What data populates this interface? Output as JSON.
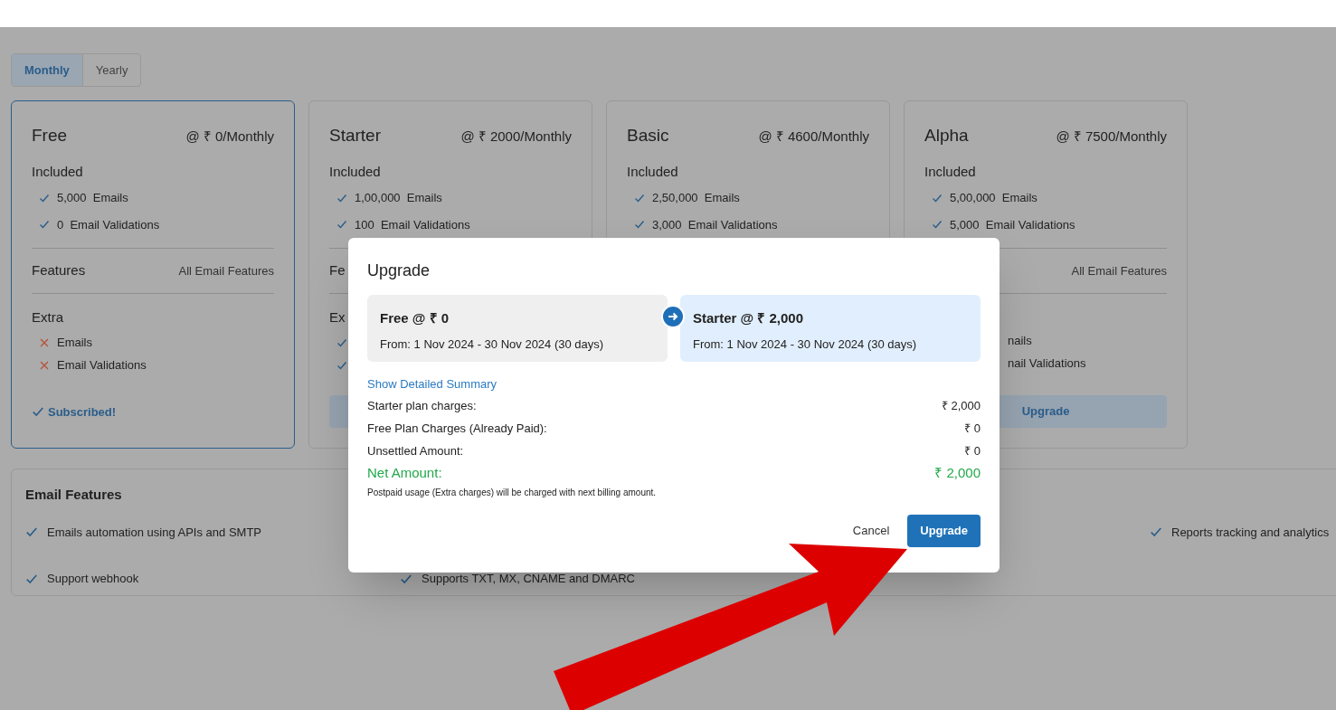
{
  "billing_tabs": [
    {
      "label": "Monthly",
      "selected": true
    },
    {
      "label": "Yearly",
      "selected": false
    }
  ],
  "plans": [
    {
      "name": "Free",
      "price": "@ ₹ 0/Monthly",
      "selected": true,
      "included_label": "Included",
      "included": [
        {
          "count": "5,000",
          "label": "Emails"
        },
        {
          "count": "0",
          "label": "Email Validations"
        }
      ],
      "features_label": "Features",
      "features_value": "All Email Features",
      "extra_label": "Extra",
      "extra": [
        {
          "kind": "cross",
          "label": "Emails"
        },
        {
          "kind": "cross",
          "label": "Email Validations"
        }
      ],
      "action": {
        "kind": "subscribed",
        "label": "Subscribed!"
      }
    },
    {
      "name": "Starter",
      "price": "@ ₹ 2000/Monthly",
      "selected": false,
      "included_label": "Included",
      "included": [
        {
          "count": "1,00,000",
          "label": "Emails"
        },
        {
          "count": "100",
          "label": "Email Validations"
        }
      ],
      "features_label": "Fe",
      "extra_label": "Ex",
      "extra": [
        {
          "kind": "check"
        },
        {
          "kind": "check"
        }
      ],
      "action": {
        "kind": "button"
      }
    },
    {
      "name": "Basic",
      "price": "@ ₹ 4600/Monthly",
      "selected": false,
      "included_label": "Included",
      "included": [
        {
          "count": "2,50,000",
          "label": "Emails"
        },
        {
          "count": "3,000",
          "label": "Email Validations"
        }
      ]
    },
    {
      "name": "Alpha",
      "price": "@ ₹ 7500/Monthly",
      "selected": false,
      "included_label": "Included",
      "included": [
        {
          "count": "5,00,000",
          "label": "Emails"
        },
        {
          "count": "5,000",
          "label": "Email Validations"
        }
      ],
      "features_value": "All Email Features",
      "extra": [
        {
          "kind": "clipped",
          "label": "nails"
        },
        {
          "kind": "clipped",
          "label": "nail Validations"
        }
      ],
      "action": {
        "kind": "button",
        "label": "Upgrade"
      }
    }
  ],
  "email_features": {
    "title": "Email Features",
    "rows": [
      [
        "Emails automation using APIs and SMTP",
        null,
        null,
        "Reports tracking and analytics"
      ],
      [
        "Support webhook",
        "Supports TXT, MX, CNAME and DMARC",
        null,
        null
      ]
    ]
  },
  "dialog": {
    "title": "Upgrade",
    "from": {
      "plan": "Free @ ₹ 0",
      "period": "From: 1 Nov 2024 - 30 Nov 2024 (30 days)"
    },
    "to": {
      "plan": "Starter @ ₹ 2,000",
      "period": "From: 1 Nov 2024 - 30 Nov 2024 (30 days)"
    },
    "summary_link": "Show Detailed Summary",
    "lines": [
      {
        "label": "Starter plan charges:",
        "value": "₹ 2,000"
      },
      {
        "label": "Free Plan Charges (Already Paid):",
        "value": "₹ 0"
      },
      {
        "label": "Unsettled Amount:",
        "value": "₹ 0"
      }
    ],
    "net": {
      "label": "Net Amount:",
      "value": "₹ 2,000"
    },
    "note": "Postpaid usage (Extra charges) will be charged with next billing amount.",
    "buttons": [
      {
        "kind": "text",
        "label": "Cancel"
      },
      {
        "kind": "primary",
        "label": "Upgrade"
      }
    ]
  }
}
